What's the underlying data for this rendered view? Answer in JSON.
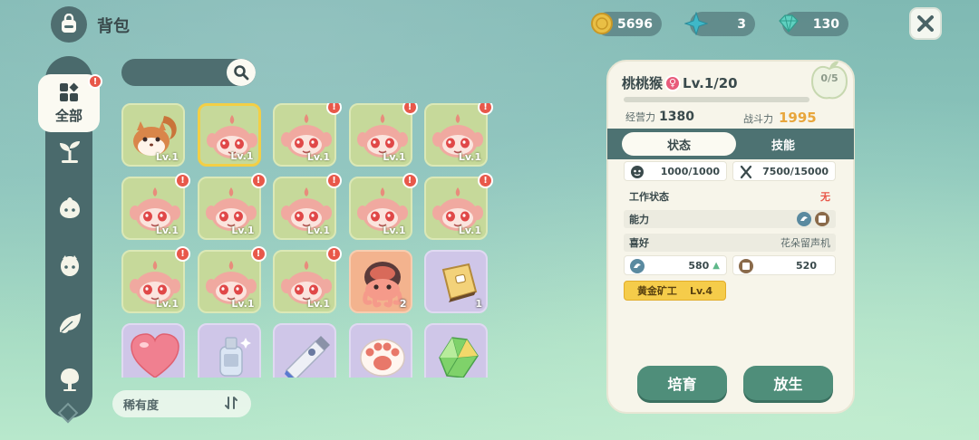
{
  "header": {
    "title": "背包",
    "bag_icon": "backpack-icon"
  },
  "resources": [
    {
      "name": "gold-coin",
      "value": "5696",
      "color": "#e2b740"
    },
    {
      "name": "star-crystal",
      "value": "3",
      "color": "#3fb8c8"
    },
    {
      "name": "gem-cluster",
      "value": "130",
      "color": "#5fd0c0"
    }
  ],
  "sidebar": {
    "active_label": "全部",
    "active_badge": "!",
    "items": [
      "all-icon",
      "sprout-icon",
      "pet-icon",
      "pet-face-icon",
      "leaf-icon",
      "tree-icon"
    ]
  },
  "search": {
    "placeholder": ""
  },
  "grid": {
    "items": [
      {
        "kind": "squirrel",
        "color": "green",
        "level": "Lv.1",
        "alert": false,
        "selected": false
      },
      {
        "kind": "monkey",
        "color": "green",
        "level": "Lv.1",
        "alert": false,
        "selected": true
      },
      {
        "kind": "monkey",
        "color": "green",
        "level": "Lv.1",
        "alert": true,
        "selected": false
      },
      {
        "kind": "monkey",
        "color": "green",
        "level": "Lv.1",
        "alert": true,
        "selected": false
      },
      {
        "kind": "monkey",
        "color": "green",
        "level": "Lv.1",
        "alert": true,
        "selected": false
      },
      {
        "kind": "monkey",
        "color": "green",
        "level": "Lv.1",
        "alert": true,
        "selected": false
      },
      {
        "kind": "monkey",
        "color": "green",
        "level": "Lv.1",
        "alert": true,
        "selected": false
      },
      {
        "kind": "monkey",
        "color": "green",
        "level": "Lv.1",
        "alert": true,
        "selected": false
      },
      {
        "kind": "monkey",
        "color": "green",
        "level": "Lv.1",
        "alert": true,
        "selected": false
      },
      {
        "kind": "monkey",
        "color": "green",
        "level": "Lv.1",
        "alert": true,
        "selected": false
      },
      {
        "kind": "monkey",
        "color": "green",
        "level": "Lv.1",
        "alert": true,
        "selected": false
      },
      {
        "kind": "monkey",
        "color": "green",
        "level": "Lv.1",
        "alert": true,
        "selected": false
      },
      {
        "kind": "monkey",
        "color": "green",
        "level": "Lv.1",
        "alert": true,
        "selected": false
      },
      {
        "kind": "octopus",
        "color": "orange",
        "count": "2",
        "alert": false,
        "selected": false
      },
      {
        "kind": "book",
        "color": "purple",
        "count": "1",
        "alert": false,
        "selected": false
      },
      {
        "kind": "heart",
        "color": "purple",
        "alert": false,
        "selected": false
      },
      {
        "kind": "bottle",
        "color": "purple",
        "alert": false,
        "selected": false
      },
      {
        "kind": "tube",
        "color": "purple",
        "alert": false,
        "selected": false
      },
      {
        "kind": "paw",
        "color": "purple",
        "alert": false,
        "selected": false
      },
      {
        "kind": "crystal",
        "color": "purple",
        "alert": false,
        "selected": false
      }
    ]
  },
  "sort": {
    "label": "稀有度"
  },
  "detail": {
    "name": "桃桃猴",
    "level": "Lv.1/20",
    "level_progress": 0.0,
    "fruit_counter": "0/5",
    "operation_label": "经营力",
    "operation_value": "1380",
    "combat_label": "战斗力",
    "combat_value": "1995",
    "tabs": [
      "状态",
      "技能"
    ],
    "hunger": "1000/1000",
    "stamina": "7500/15000",
    "work_status_label": "工作状态",
    "work_status_value": "无",
    "ability_label": "能力",
    "likes_label": "喜好",
    "likes_value": "花朵留声机",
    "skill1_value": "580",
    "skill2_value": "520",
    "trait_name": "黄金矿工",
    "trait_level": "Lv.4",
    "buttons": {
      "nurture": "培育",
      "release": "放生"
    }
  }
}
